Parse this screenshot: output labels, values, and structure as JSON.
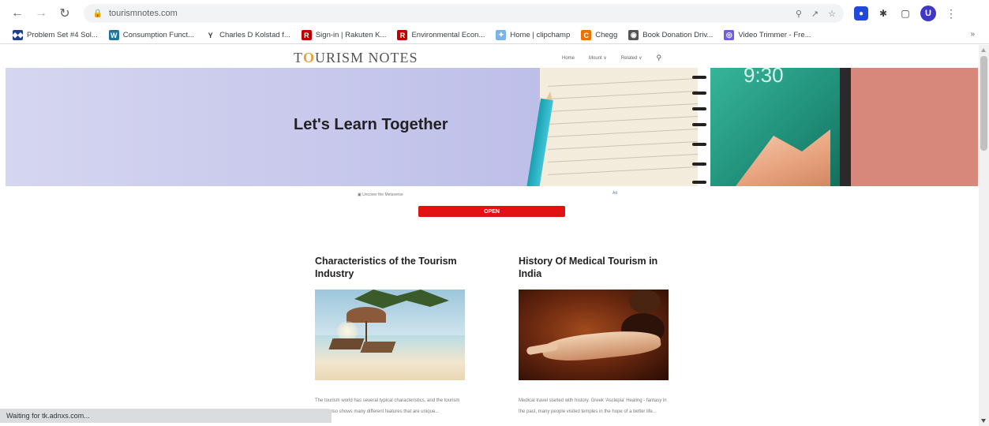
{
  "browser": {
    "url": "tourismnotes.com",
    "status": "Waiting for tk.adnxs.com...",
    "bookmarks": [
      {
        "label": "Problem Set #4 Sol...",
        "icon": "◆◆",
        "color": "#1f3f8f"
      },
      {
        "label": "Consumption Funct...",
        "icon": "W",
        "color": "#21759b"
      },
      {
        "label": "Charles D Kolstad f...",
        "icon": "Y",
        "color": "#ffffff"
      },
      {
        "label": "Sign-in | Rakuten K...",
        "icon": "R",
        "color": "#bf0000"
      },
      {
        "label": "Environmental Econ...",
        "icon": "R",
        "color": "#bf0000"
      },
      {
        "label": "Home | clipchamp",
        "icon": "✦",
        "color": "#7bb3e8"
      },
      {
        "label": "Chegg",
        "icon": "C",
        "color": "#eb7100"
      },
      {
        "label": "Book Donation Driv...",
        "icon": "◉",
        "color": "#555555"
      },
      {
        "label": "Video Trimmer - Fre...",
        "icon": "◎",
        "color": "#6c5ce7"
      }
    ],
    "bookmarks_more": "»",
    "avatar_letter": "U"
  },
  "site": {
    "logo_prefix": "T",
    "logo_o": "O",
    "logo_rest": "URISM NOTES",
    "nav": [
      "Home",
      "Mount ∨",
      "Related ∨"
    ],
    "hero_title": "Let's Learn Together",
    "phone_time": "9:30",
    "ad_text": "▣  Uncover the Metaverse",
    "ad_badge": "Ad",
    "open_label": "OPEN"
  },
  "posts": [
    {
      "title": "Characteristics of the Tourism Industry",
      "excerpt": "The tourism world has several typical characteristics, and the tourism sector also shows many different features that are unique..."
    },
    {
      "title": "History Of Medical Tourism in India",
      "excerpt": "Medical travel started with history. Greek 'Asclepia' Healing - fantasy in the past, many people visited temples in the hope of a better life..."
    }
  ]
}
